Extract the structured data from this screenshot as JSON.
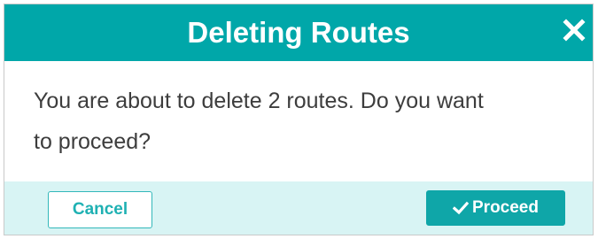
{
  "dialog": {
    "title": "Deleting Routes",
    "message_line1": "You are about to delete 2 routes. Do you want",
    "message_line2": "to proceed?",
    "close_icon": "close-icon",
    "cancel_label": "Cancel",
    "proceed_label": "Proceed",
    "proceed_icon": "check-icon"
  },
  "colors": {
    "header": "#00a7a9",
    "footer": "#d8f4f4",
    "primary_button": "#0fa6a8",
    "cancel_text": "#1fb1b3"
  }
}
